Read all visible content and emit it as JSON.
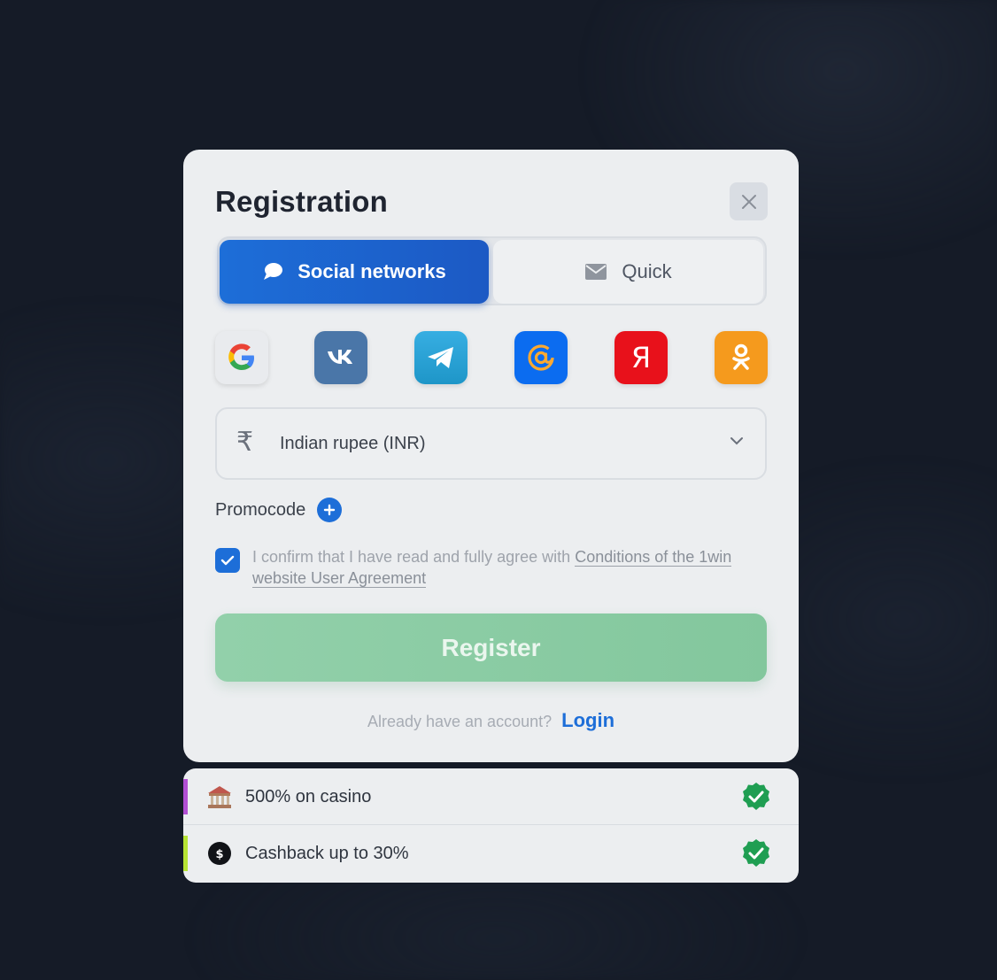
{
  "modal": {
    "title": "Registration",
    "close_label": "close"
  },
  "tabs": [
    {
      "label": "Social networks",
      "active": true,
      "icon": "chat-bubble-icon"
    },
    {
      "label": "Quick",
      "active": false,
      "icon": "envelope-icon"
    }
  ],
  "social_logins": [
    {
      "name": "google",
      "glyph": "G",
      "color": "#e9ebee"
    },
    {
      "name": "vk",
      "glyph": "VK",
      "color": "#4a76a8"
    },
    {
      "name": "telegram",
      "glyph": "",
      "color": "#2aa3dc"
    },
    {
      "name": "mail",
      "glyph": "@",
      "color": "#0b6cf0"
    },
    {
      "name": "yandex",
      "glyph": "Я",
      "color": "#e8111b"
    },
    {
      "name": "odnoklassniki",
      "glyph": "",
      "color": "#f59a1d"
    }
  ],
  "currency": {
    "symbol": "₹",
    "label": "Indian rupee (INR)"
  },
  "promocode": {
    "label": "Promocode"
  },
  "agreement": {
    "checked": true,
    "text": "I confirm that I have read and fully agree with ",
    "link_text": "Conditions of the 1win website User Agreement"
  },
  "register": {
    "label": "Register"
  },
  "login": {
    "prompt": "Already have an account?",
    "link": "Login"
  },
  "bonuses": [
    {
      "text": "500% on casino",
      "bar_color": "#b24fd3",
      "icon": "casino-building-icon"
    },
    {
      "text": "Cashback up to 30%",
      "bar_color": "#b6e334",
      "icon": "cashback-coin-icon"
    }
  ],
  "colors": {
    "accent": "#1d6ed8",
    "register": "#8ccda5",
    "check_green": "#1f9e52",
    "background": "#151b27"
  }
}
